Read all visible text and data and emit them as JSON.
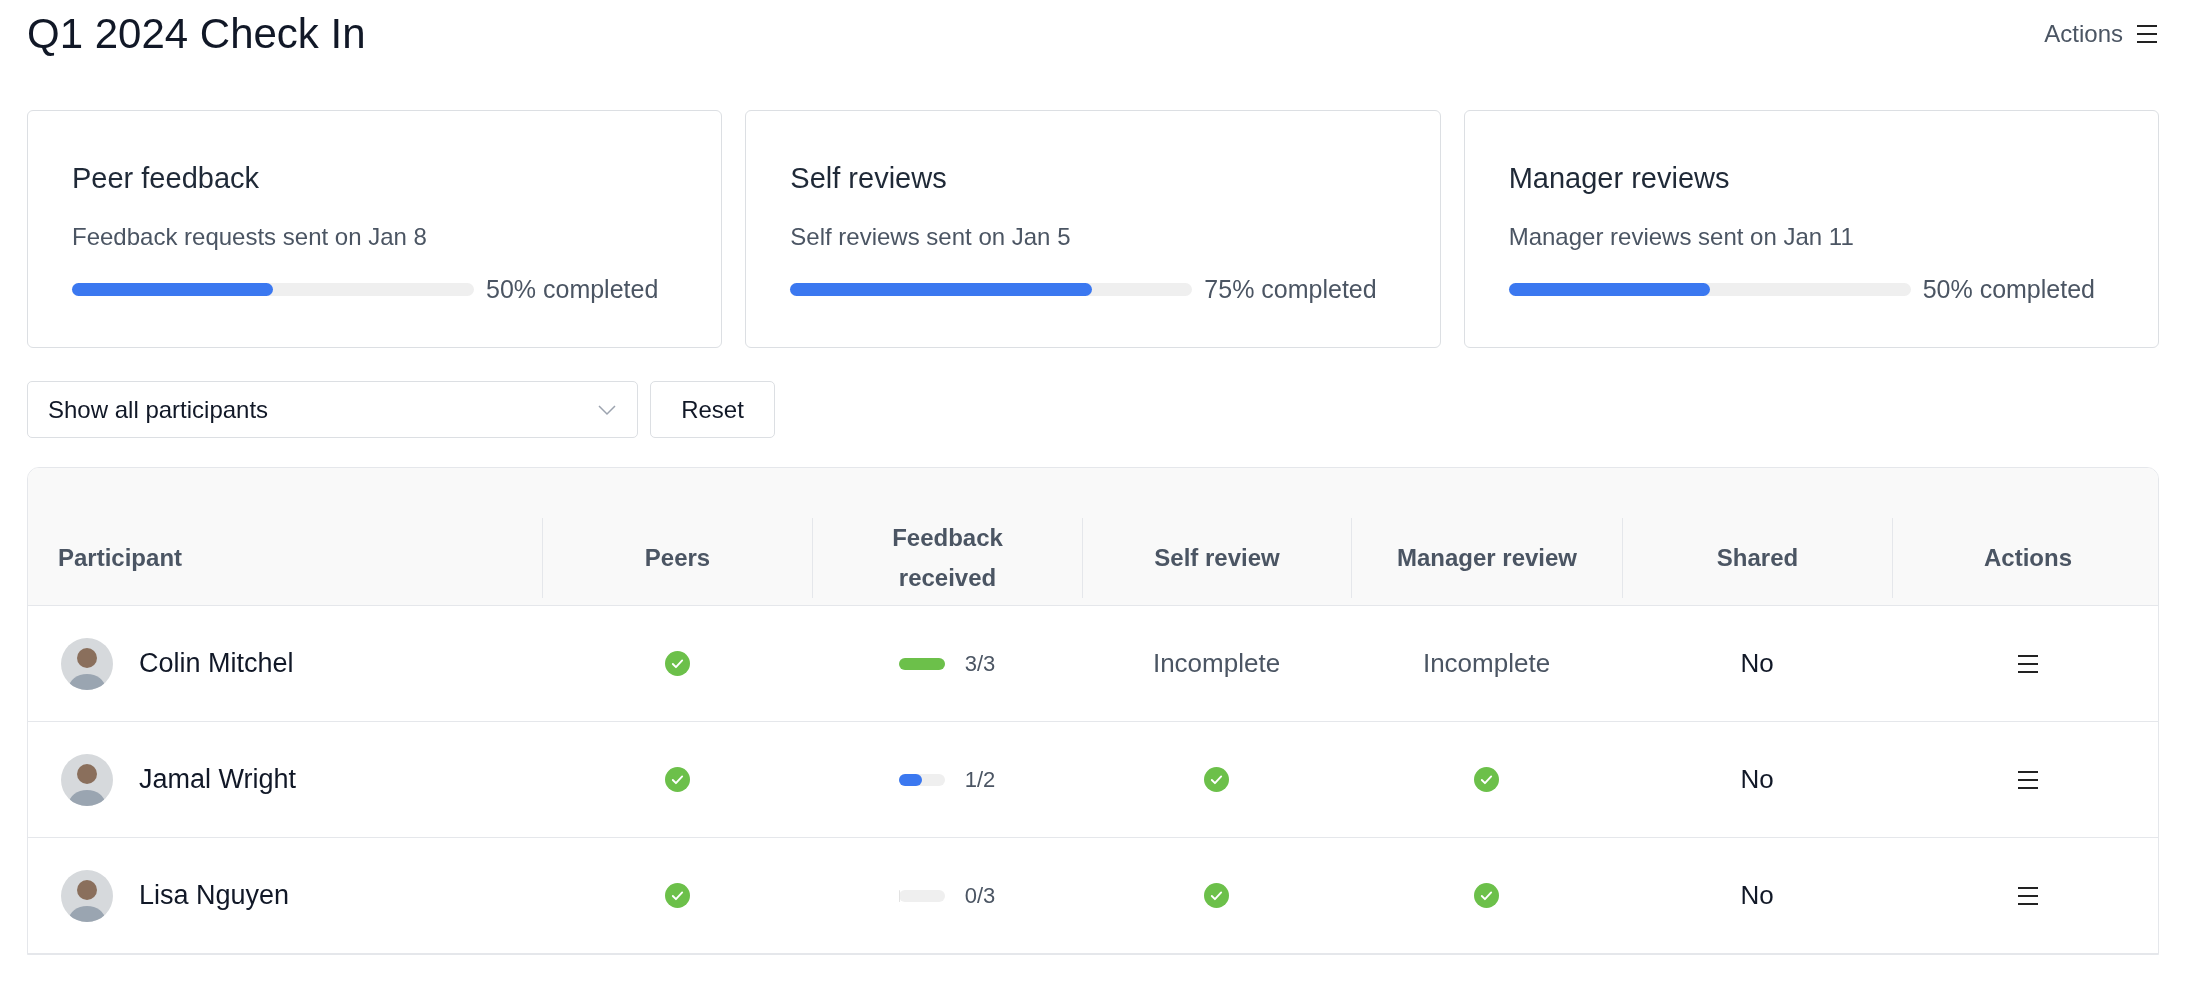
{
  "title": "Q1 2024 Check In",
  "actions_menu": {
    "label": "Actions"
  },
  "cards": [
    {
      "title": "Peer feedback",
      "subtitle": "Feedback requests sent on Jan 8",
      "level": 0.5,
      "reading": "50% completed"
    },
    {
      "title": "Self reviews",
      "subtitle": "Self reviews sent on Jan 5",
      "level": 0.75,
      "reading": "75% completed"
    },
    {
      "title": "Manager reviews",
      "subtitle": "Manager reviews sent on Jan 11",
      "level": 0.5,
      "reading": "50% completed"
    }
  ],
  "filter": {
    "value": "Show all participants"
  },
  "reset_button": "Reset",
  "table": {
    "columns": [
      "Participant",
      "Peers",
      "Feedback received",
      "Self review",
      "Manager review",
      "Shared",
      "Actions"
    ],
    "rows": [
      {
        "name": "Colin Mitchel",
        "peers": {
          "kind": "check"
        },
        "feedback": {
          "level": 1,
          "color": "#6cc04a",
          "reading": "3/3"
        },
        "self_review": {
          "kind": "text",
          "text": "Incomplete"
        },
        "manager_review": {
          "kind": "text",
          "text": "Incomplete"
        },
        "shared": "No"
      },
      {
        "name": "Jamal Wright",
        "peers": {
          "kind": "check"
        },
        "feedback": {
          "level": 0.5,
          "color": "#3b78f0",
          "reading": "1/2"
        },
        "self_review": {
          "kind": "check"
        },
        "manager_review": {
          "kind": "check"
        },
        "shared": "No"
      },
      {
        "name": "Lisa Nguyen",
        "peers": {
          "kind": "check"
        },
        "feedback": {
          "level": 0,
          "reading": "0/3"
        },
        "self_review": {
          "kind": "check"
        },
        "manager_review": {
          "kind": "check"
        },
        "shared": "No"
      }
    ]
  }
}
